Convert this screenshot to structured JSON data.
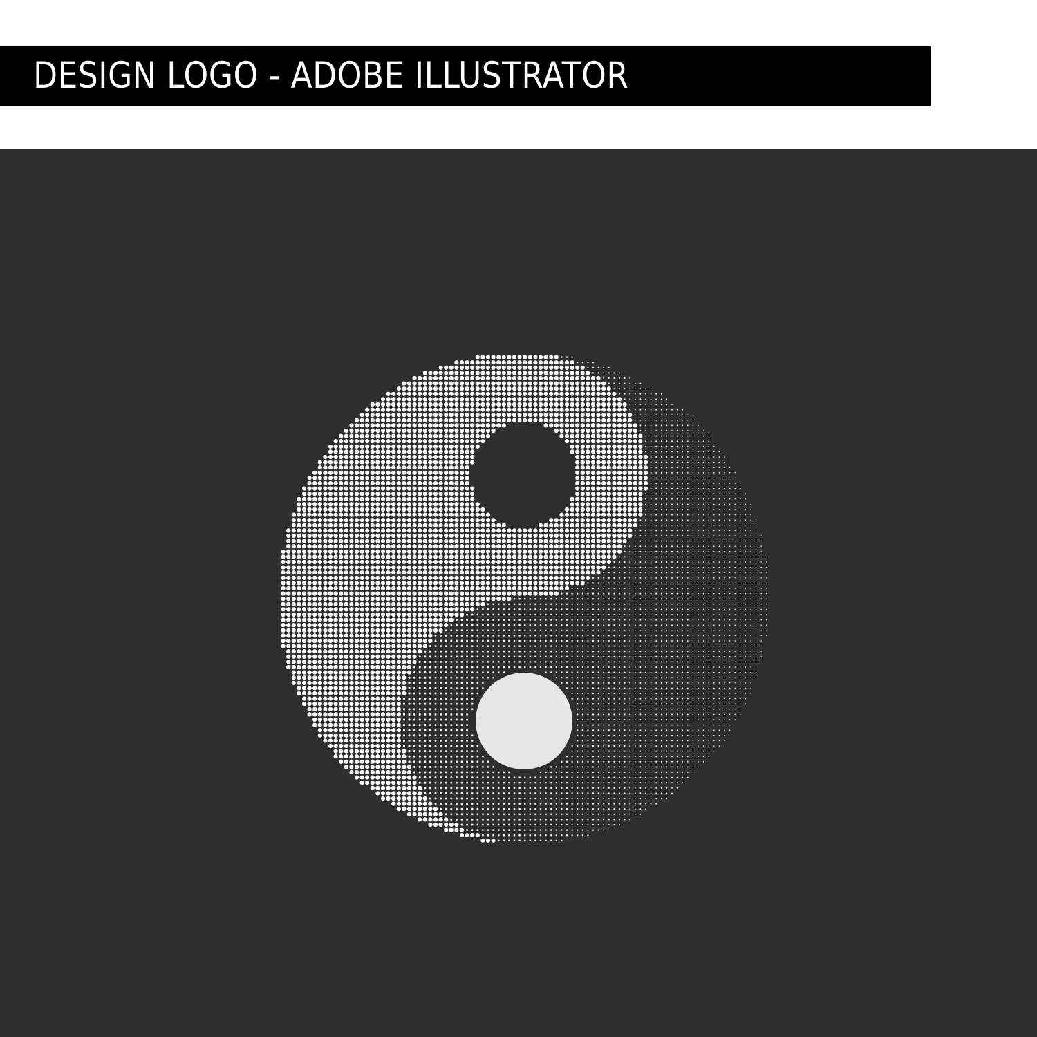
{
  "header": {
    "title": "DESIGN LOGO - ADOBE ILLUSTRATOR"
  },
  "logo": {
    "symbol": "yin-yang-icon",
    "style": "halftone dots",
    "colors": {
      "background": "#2e2e2e",
      "dots": "#ffffff",
      "eye_light": "#e6e6e6",
      "eye_dark": "#2e2e2e"
    }
  }
}
